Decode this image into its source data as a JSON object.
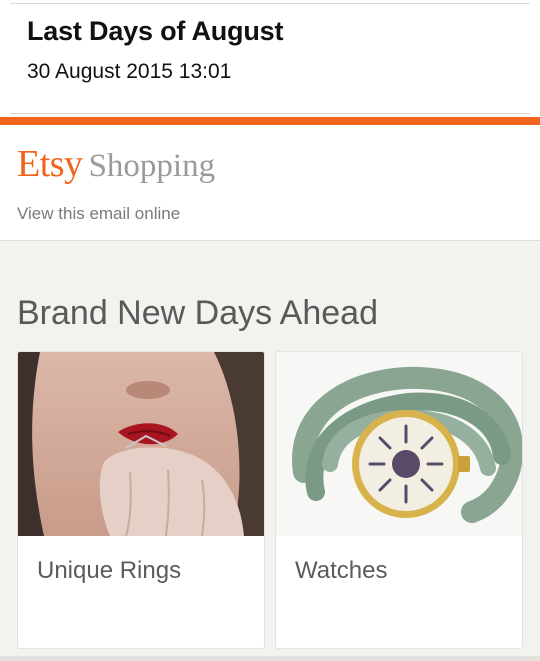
{
  "email": {
    "subject": "Last Days of August",
    "date": "30 August 2015 13:01"
  },
  "header": {
    "brand_primary": "Etsy",
    "brand_secondary": "Shopping",
    "view_online": "View this email online"
  },
  "main": {
    "section_title": "Brand New Days Ahead",
    "cards": [
      {
        "label": "Unique Rings",
        "image": "ring-photo"
      },
      {
        "label": "Watches",
        "image": "wrap-watch-photo"
      }
    ]
  },
  "colors": {
    "accent": "#f1641e",
    "background": "#f2f2ef"
  }
}
